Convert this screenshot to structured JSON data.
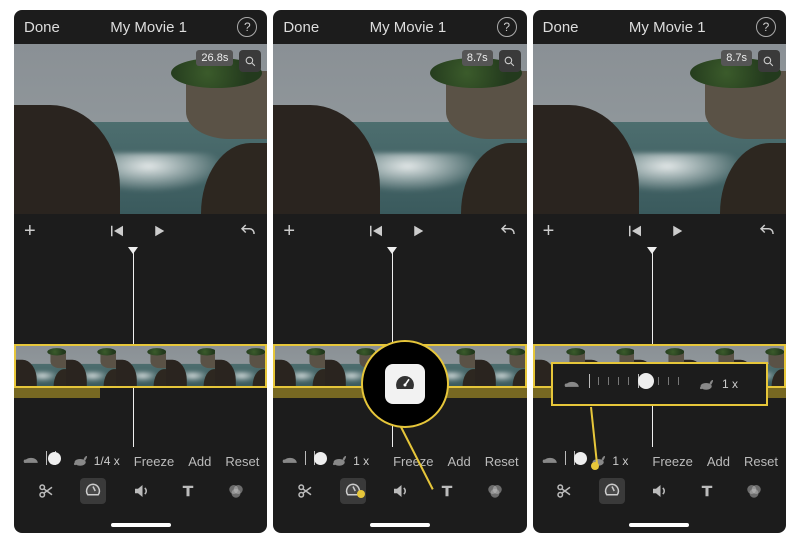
{
  "screens": [
    {
      "header": {
        "done": "Done",
        "title": "My Movie 1"
      },
      "preview": {
        "duration_badge": "26.8s"
      },
      "speedrow": {
        "value_label": "1/4 x",
        "knob_pct": 14
      },
      "actions": {
        "freeze": "Freeze",
        "add": "Add",
        "reset": "Reset"
      },
      "tool_selected": "speed",
      "speedband": "narrow"
    },
    {
      "header": {
        "done": "Done",
        "title": "My Movie 1"
      },
      "preview": {
        "duration_badge": "8.7s"
      },
      "speedrow": {
        "value_label": "1 x",
        "knob_pct": 50
      },
      "actions": {
        "freeze": "Freeze",
        "add": "Add",
        "reset": "Reset"
      },
      "tool_selected": "speed",
      "speedband": "full",
      "callout": "circle"
    },
    {
      "header": {
        "done": "Done",
        "title": "My Movie 1"
      },
      "preview": {
        "duration_badge": "8.7s"
      },
      "speedrow": {
        "value_label": "1 x",
        "knob_pct": 50
      },
      "actions": {
        "freeze": "Freeze",
        "add": "Add",
        "reset": "Reset"
      },
      "tool_selected": "speed",
      "speedband": "full",
      "callout": "rect",
      "callout_rect": {
        "value_label": "1 x",
        "knob_pct": 50
      }
    }
  ],
  "icons": {
    "help": "?",
    "plus": "+"
  },
  "colors": {
    "accent": "#e6c63a"
  }
}
